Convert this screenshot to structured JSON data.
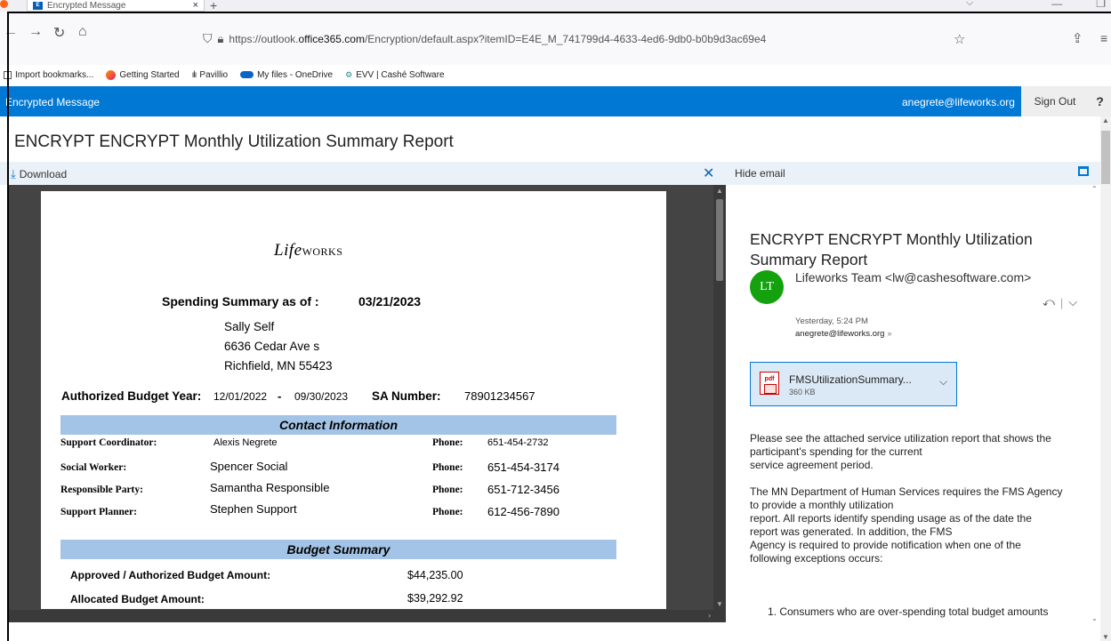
{
  "browser": {
    "tab_title": "Encrypted Message",
    "tab_close": "×",
    "new_tab": "+",
    "url_host_prefix": "https://outlook.",
    "url_host": "office365.com",
    "url_path": "/Encryption/default.aspx?itemID=E4E_M_741799d4-4633-4ed6-9db0-b0b9d3ac69e4",
    "bookmarks": [
      {
        "label": "Import bookmarks...",
        "icon": "import-icon"
      },
      {
        "label": "Getting Started",
        "icon": "firefox-icon"
      },
      {
        "label": "Pavillio",
        "icon": "bars-icon"
      },
      {
        "label": "My files - OneDrive",
        "icon": "onedrive-icon"
      },
      {
        "label": "EVV | Cashé Software",
        "icon": "evv-icon"
      }
    ]
  },
  "app": {
    "title": "Encrypted Message",
    "user_email": "anegrete@lifeworks.org",
    "sign_out": "Sign Out",
    "help": "?",
    "subject": "ENCRYPT ENCRYPT Monthly Utilization Summary Report",
    "download": "Download",
    "hide_email": "Hide email"
  },
  "document": {
    "logo_prefix": "Life",
    "logo_suffix": "works",
    "summary_label": "Spending Summary as of :",
    "summary_date": "03/21/2023",
    "name": "Sally Self",
    "street": "6636 Cedar Ave s",
    "city": "Richfield, MN 55423",
    "budget_year_label": "Authorized Budget Year:",
    "budget_start": "12/01/2022",
    "budget_dash": "-",
    "budget_end": "09/30/2023",
    "sa_label": "SA Number:",
    "sa_number": "78901234567",
    "contact_header": "Contact Information",
    "phone_label": "Phone:",
    "contacts": [
      {
        "role": "Support Coordinator:",
        "name": "Alexis Negrete",
        "phone": "651-454-2732"
      },
      {
        "role": "Social Worker:",
        "name": "Spencer Social",
        "phone": "651-454-3174"
      },
      {
        "role": "Responsible Party:",
        "name": "Samantha Responsible",
        "phone": "651-712-3456"
      },
      {
        "role": "Support Planner:",
        "name": "Stephen Support",
        "phone": "612-456-7890"
      }
    ],
    "budget_header": "Budget Summary",
    "budget_rows": [
      {
        "label": "Approved / Authorized Budget Amount:",
        "value": "$44,235.00"
      },
      {
        "label": "Allocated Budget Amount:",
        "value": "$39,292.92"
      }
    ]
  },
  "email": {
    "subject": "ENCRYPT ENCRYPT Monthly Utilization Summary Report",
    "avatar_initials": "LT",
    "sender": "Lifeworks Team <lw@cashesoftware.com>",
    "date": "Yesterday, 5:24 PM",
    "to": "anegrete@lifeworks.org",
    "attachment_name": "FMSUtilizationSummary...",
    "attachment_size": "360 KB",
    "body_p1_l1": "Please see the attached service utilization report that shows the",
    "body_p1_l2": "participant's spending for the current",
    "body_p1_l3": "service agreement period.",
    "body_p2_l1": "The MN Department of Human Services requires the FMS Agency",
    "body_p2_l2": "to provide a monthly utilization",
    "body_p2_l3": "report. All reports identify spending usage as of the date the",
    "body_p2_l4": "report was generated. In addition, the FMS",
    "body_p2_l5": "Agency is required to provide notification when one of the",
    "body_p2_l6": "following exceptions occurs:",
    "list_item_1": "1. Consumers who are over-spending total budget amounts"
  },
  "colors": {
    "header_blue": "#0078d4",
    "section_blue": "#a3c4e6",
    "avatar_green": "#13a10e",
    "viewer_gray": "#444444"
  }
}
